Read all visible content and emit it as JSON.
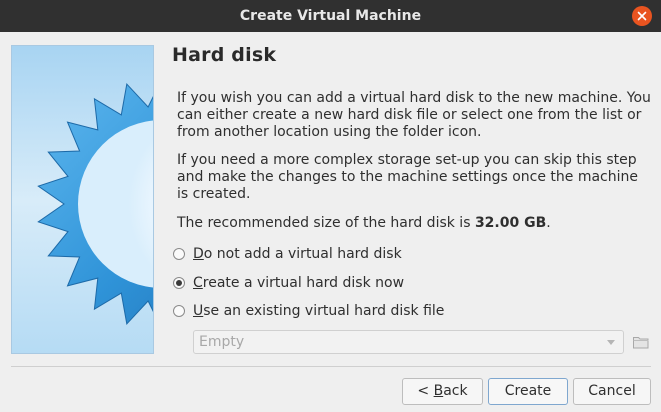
{
  "window": {
    "title": "Create Virtual Machine"
  },
  "page": {
    "title": "Hard disk",
    "paragraph1": "If you wish you can add a virtual hard disk to the new machine. You can either create a new hard disk file or select one from the list or from another location using the folder icon.",
    "paragraph2": "If you need a more complex storage set-up you can skip this step and make the changes to the machine settings once the machine is created.",
    "recommended_prefix": "The recommended size of the hard disk is ",
    "recommended_size": "32.00 GB",
    "recommended_suffix": "."
  },
  "options": [
    {
      "mnemonic": "D",
      "rest": "o not add a virtual hard disk",
      "checked": false
    },
    {
      "mnemonic": "C",
      "rest": "reate a virtual hard disk now",
      "checked": true
    },
    {
      "mnemonic": "U",
      "rest": "se an existing virtual hard disk file",
      "checked": false
    }
  ],
  "existing_disk": {
    "value": "Empty",
    "enabled": false
  },
  "buttons": {
    "back_prefix": "< ",
    "back_mnemonic": "B",
    "back_rest": "ack",
    "create": "Create",
    "cancel": "Cancel"
  },
  "colors": {
    "titlebar": "#303030",
    "close": "#e95420",
    "accent_border": "#7fa7cf"
  },
  "icons": {
    "close": "close-icon",
    "folder": "folder-icon",
    "dropdown": "chevron-down-icon"
  }
}
